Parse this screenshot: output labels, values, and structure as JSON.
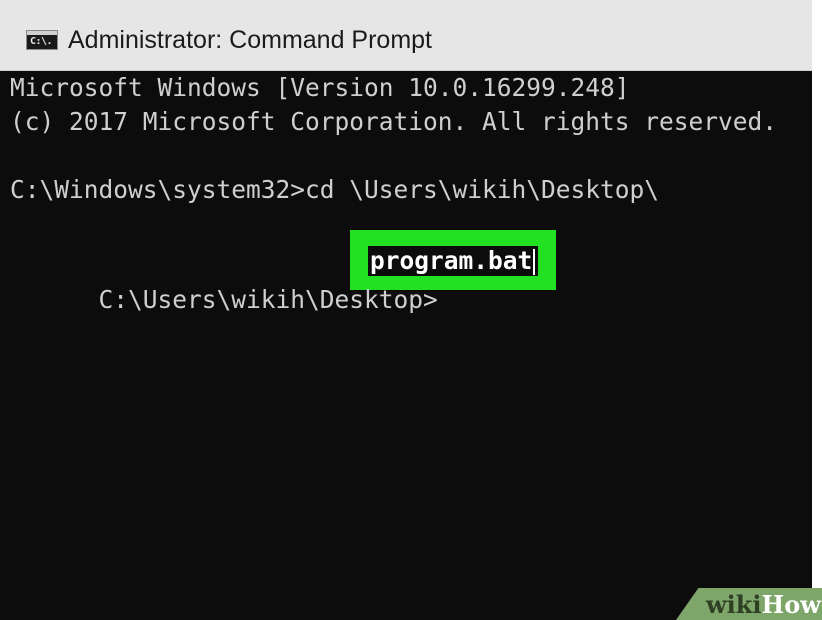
{
  "window": {
    "title": "Administrator: Command Prompt",
    "icon": "cmd-icon",
    "icon_glyph": "C:\\."
  },
  "console": {
    "lines": [
      "Microsoft Windows [Version 10.0.16299.248]",
      "(c) 2017 Microsoft Corporation. All rights reserved.",
      "C:\\Windows\\system32>cd \\Users\\wikih\\Desktop\\",
      "C:\\Users\\wikih\\Desktop>"
    ],
    "typed_command": "program.bat",
    "highlight_color": "#22e022"
  },
  "watermark": {
    "part1": "wiki",
    "part2": "How"
  }
}
